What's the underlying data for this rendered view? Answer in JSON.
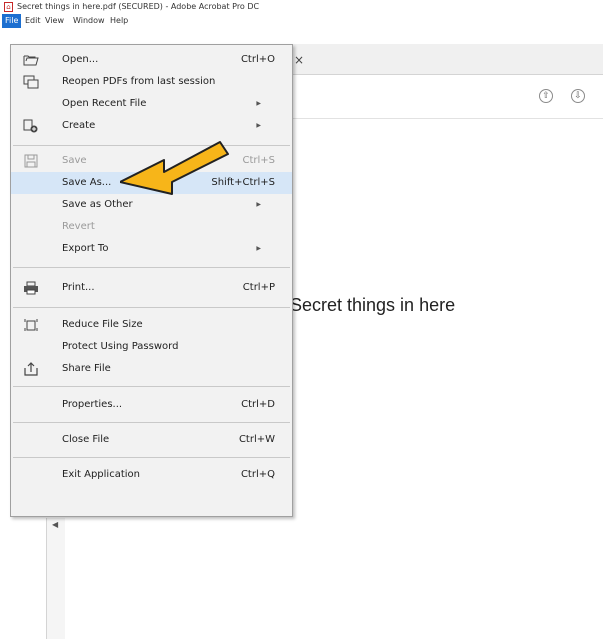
{
  "window": {
    "title": "Secret things in here.pdf (SECURED) - Adobe Acrobat Pro DC"
  },
  "menubar": {
    "items": [
      "File",
      "Edit",
      "View",
      "Window",
      "Help"
    ]
  },
  "document": {
    "body_text": "Secret things in here"
  },
  "file_menu": {
    "open": {
      "label": "Open...",
      "shortcut": "Ctrl+O"
    },
    "reopen": {
      "label": "Reopen PDFs from last session"
    },
    "open_recent": {
      "label": "Open Recent File"
    },
    "create": {
      "label": "Create"
    },
    "save": {
      "label": "Save",
      "shortcut": "Ctrl+S"
    },
    "save_as": {
      "label": "Save As...",
      "shortcut": "Shift+Ctrl+S"
    },
    "save_as_other": {
      "label": "Save as Other"
    },
    "revert": {
      "label": "Revert"
    },
    "export_to": {
      "label": "Export To"
    },
    "print": {
      "label": "Print...",
      "shortcut": "Ctrl+P"
    },
    "reduce_size": {
      "label": "Reduce File Size"
    },
    "protect": {
      "label": "Protect Using Password"
    },
    "share": {
      "label": "Share File"
    },
    "properties": {
      "label": "Properties...",
      "shortcut": "Ctrl+D"
    },
    "close": {
      "label": "Close File",
      "shortcut": "Ctrl+W"
    },
    "exit": {
      "label": "Exit Application",
      "shortcut": "Ctrl+Q"
    }
  },
  "tab": {
    "close_glyph": "×"
  },
  "nav": {
    "up_glyph": "⇧",
    "down_glyph": "⇩"
  },
  "colors": {
    "menu_active": "#1c6fd0",
    "highlight_row": "#d6e6f7",
    "annotation_arrow": "#f7b519"
  }
}
